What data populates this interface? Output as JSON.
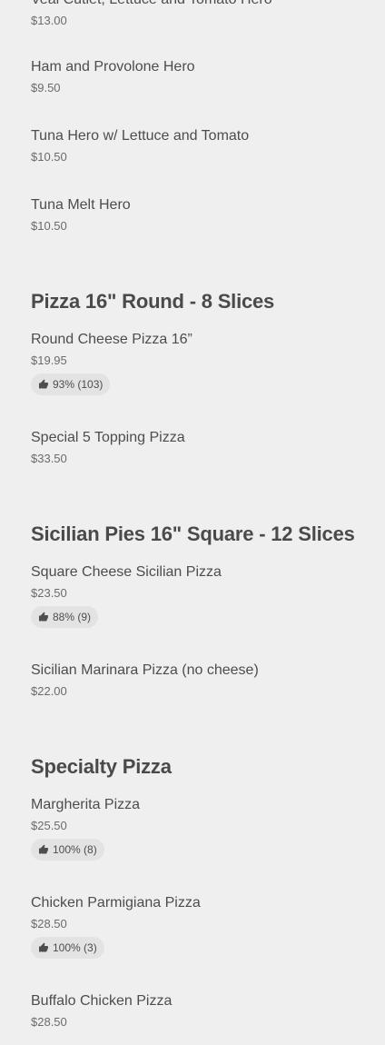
{
  "sections": [
    {
      "title": null,
      "items": [
        {
          "name": "Veal Cutlet, Lettuce and Tomato Hero",
          "price": "$13.00"
        },
        {
          "name": "Ham and Provolone Hero",
          "price": "$9.50"
        },
        {
          "name": "Tuna Hero w/ Lettuce and Tomato",
          "price": "$10.50"
        },
        {
          "name": "Tuna Melt Hero",
          "price": "$10.50"
        }
      ]
    },
    {
      "title": "Pizza 16\" Round - 8 Slices",
      "items": [
        {
          "name": "Round Cheese Pizza 16”",
          "price": "$19.95",
          "rating": "93% (103)"
        },
        {
          "name": "Special 5 Topping Pizza",
          "price": "$33.50"
        }
      ]
    },
    {
      "title": "Sicilian Pies 16\" Square - 12 Slices",
      "items": [
        {
          "name": "Square Cheese Sicilian Pizza",
          "price": "$23.50",
          "rating": "88% (9)"
        },
        {
          "name": "Sicilian Marinara Pizza (no cheese)",
          "price": "$22.00"
        }
      ]
    },
    {
      "title": "Specialty Pizza",
      "items": [
        {
          "name": "Margherita Pizza",
          "price": "$25.50",
          "rating": "100% (8)"
        },
        {
          "name": "Chicken Parmigiana Pizza",
          "price": "$28.50",
          "rating": "100% (3)"
        },
        {
          "name": "Buffalo Chicken Pizza",
          "price": "$28.50"
        }
      ]
    }
  ],
  "icons": {
    "rating": "thumbs-up-icon"
  },
  "colors": {
    "background": "#efefef",
    "text": "#4a4a4a",
    "badge": "#e3e3e3"
  }
}
